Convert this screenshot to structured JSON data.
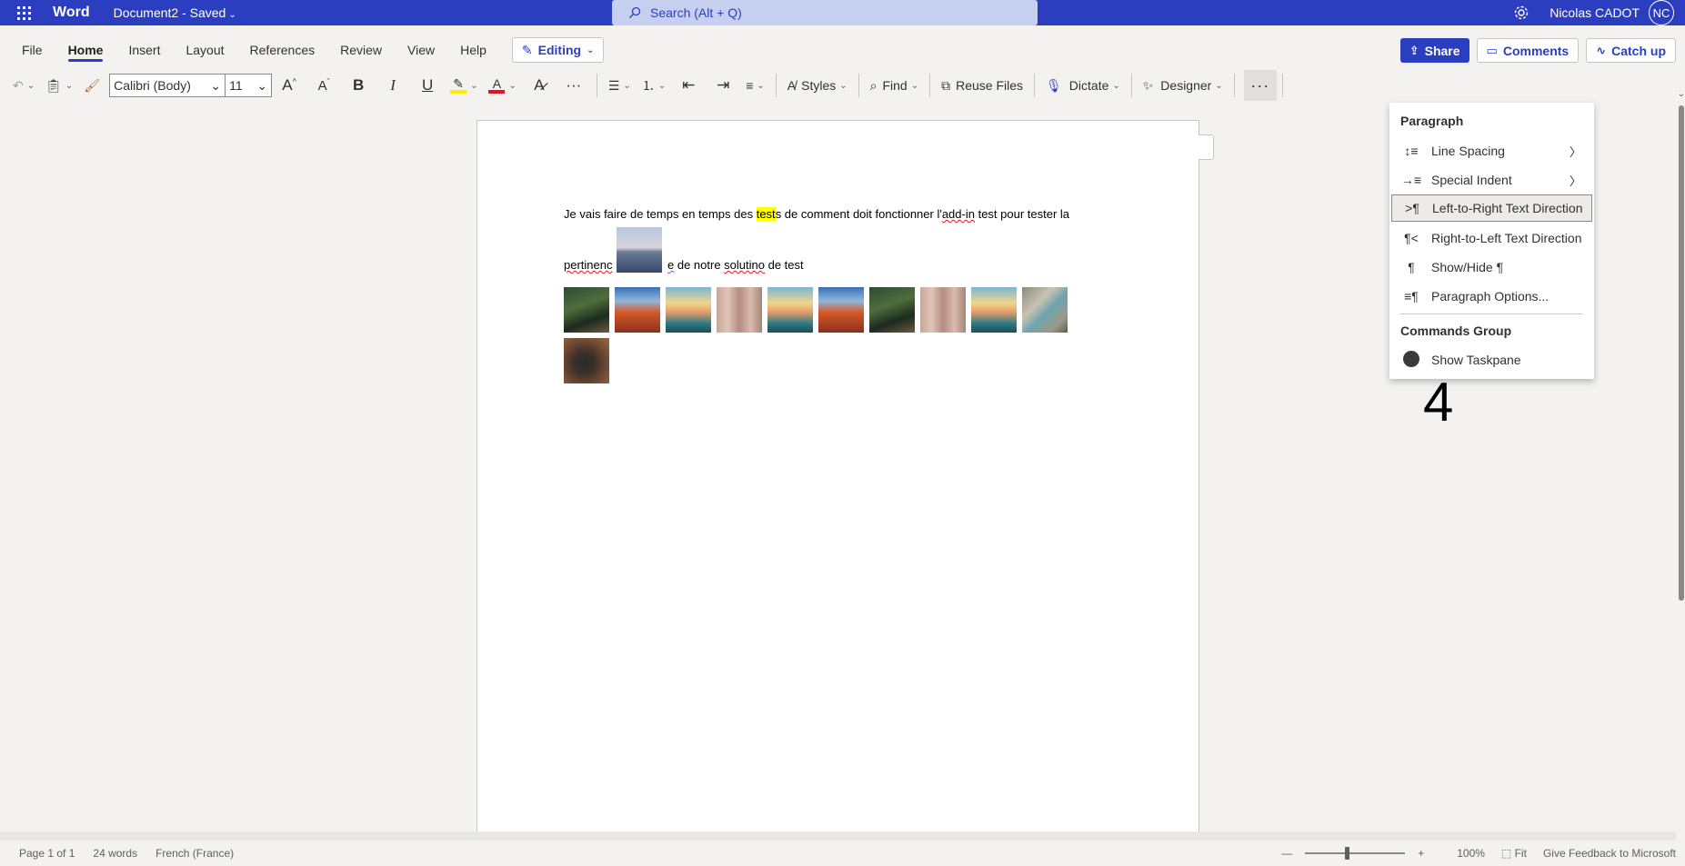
{
  "titlebar": {
    "app_name": "Word",
    "doc_name": "Document2",
    "doc_status": "Saved",
    "search_placeholder": "Search (Alt + Q)",
    "user_name": "Nicolas CADOT",
    "avatar_initials": "NC",
    "bg_color": "#2b3ebf"
  },
  "menu": {
    "tabs": [
      "File",
      "Home",
      "Insert",
      "Layout",
      "References",
      "Review",
      "View",
      "Help"
    ],
    "active_tab": "Home",
    "editing_label": "Editing",
    "share_label": "Share",
    "comments_label": "Comments",
    "catchup_label": "Catch up"
  },
  "ribbon": {
    "font_name": "Calibri (Body)",
    "font_size": "11",
    "styles_label": "Styles",
    "find_label": "Find",
    "reuse_label": "Reuse Files",
    "dictate_label": "Dictate",
    "designer_label": "Designer",
    "more_label": "···",
    "icons": [
      "undo-icon",
      "clipboard-icon",
      "format-painter-icon",
      "grow-font-icon",
      "shrink-font-icon",
      "bold-icon",
      "italic-icon",
      "underline-icon",
      "highlight-icon",
      "font-color-icon",
      "clear-format-icon",
      "more-font-icon",
      "bullets-icon",
      "numbering-icon",
      "decrease-indent-icon",
      "increase-indent-icon",
      "align-icon",
      "styles-icon",
      "find-icon",
      "reuse-files-icon",
      "microphone-icon",
      "designer-icon"
    ]
  },
  "document": {
    "line1_pre": "Je vais faire de temps en temps des ",
    "line1_hl": "test",
    "line1_post_a": "s de comment doit fonctionner l'",
    "line1_squig": "add-in",
    "line1_post_b": " test pour tester la",
    "line2_a": "pertinenc",
    "line2_b_squig": "e",
    "line2_c": " de notre ",
    "line2_d_squig": "solutino",
    "line2_e": " de test",
    "thumbnails": [
      "forest",
      "canyon",
      "canal",
      "wood",
      "canal",
      "canyon",
      "forest",
      "wood",
      "canal",
      "map",
      "dark"
    ]
  },
  "dropdown": {
    "paragraph_header": "Paragraph",
    "items": [
      {
        "label": "Line Spacing",
        "icon": "line-spacing-icon",
        "glyph": "↕≡",
        "submenu": true
      },
      {
        "label": "Special Indent",
        "icon": "special-indent-icon",
        "glyph": "→≡",
        "submenu": true
      },
      {
        "label": "Left-to-Right Text Direction",
        "icon": "ltr-direction-icon",
        "glyph": ">¶",
        "selected": true
      },
      {
        "label": "Right-to-Left Text Direction",
        "icon": "rtl-direction-icon",
        "glyph": "¶<"
      },
      {
        "label": "Show/Hide ¶",
        "icon": "pilcrow-icon",
        "glyph": "¶"
      },
      {
        "label": "Paragraph Options...",
        "icon": "paragraph-options-icon",
        "glyph": "≡¶"
      }
    ],
    "commands_header": "Commands Group",
    "taskpane_label": "Show Taskpane",
    "submenu_glyph": "〉"
  },
  "overlay_number": "4",
  "statusbar": {
    "page": "Page 1 of 1",
    "words": "24 words",
    "language": "French (France)",
    "zoom_minus": "—",
    "zoom_plus": "+",
    "zoom_level": "100%",
    "fit_label": "Fit",
    "feedback": "Give Feedback to Microsoft"
  }
}
